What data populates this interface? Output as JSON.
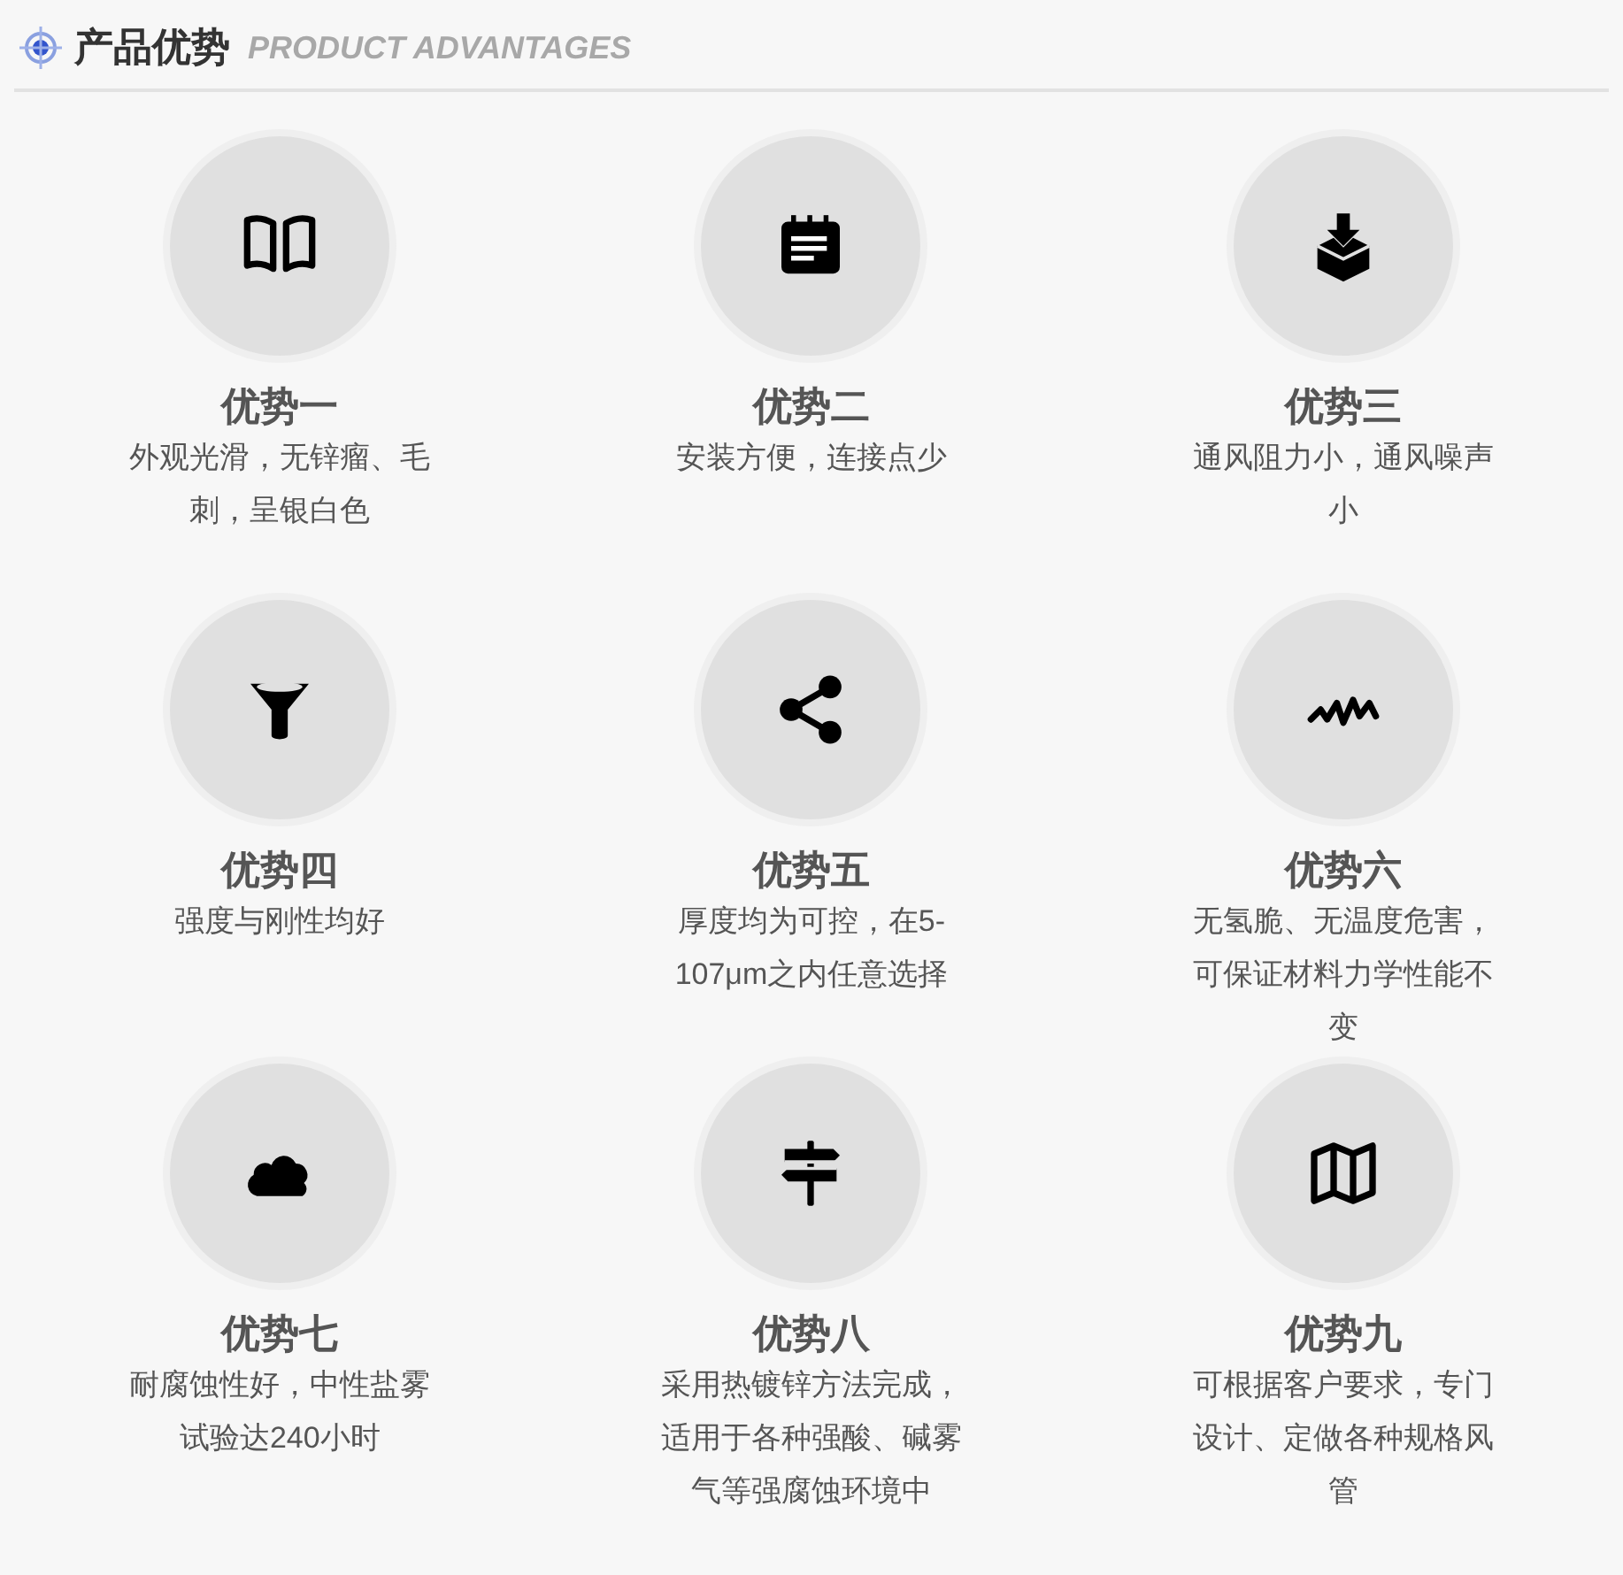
{
  "header": {
    "title": "产品优势",
    "subtitle": "PRODUCT ADVANTAGES"
  },
  "advantages": [
    {
      "title": "优势一",
      "description": "外观光滑，无锌瘤、毛刺，呈银白色"
    },
    {
      "title": "优势二",
      "description": "安装方便，连接点少"
    },
    {
      "title": "优势三",
      "description": "通风阻力小，通风噪声小"
    },
    {
      "title": "优势四",
      "description": "强度与刚性均好"
    },
    {
      "title": "优势五",
      "description": "厚度均为可控，在5-107μm之内任意选择"
    },
    {
      "title": "优势六",
      "description": "无氢脆、无温度危害，可保证材料力学性能不变"
    },
    {
      "title": "优势七",
      "description": "耐腐蚀性好，中性盐雾试验达240小时"
    },
    {
      "title": "优势八",
      "description": "采用热镀锌方法完成，适用于各种强酸、碱雾气等强腐蚀环境中"
    },
    {
      "title": "优势九",
      "description": "可根据客户要求，专门设计、定做各种规格风管"
    }
  ]
}
